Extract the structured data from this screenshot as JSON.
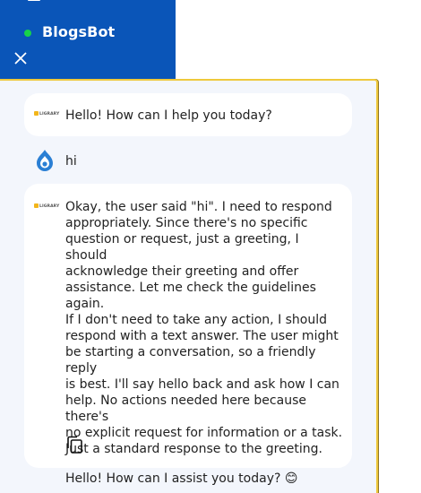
{
  "header": {
    "bot_name": "BlogsBot",
    "status_color": "#17d34b",
    "background": "#0a55b8"
  },
  "messages": [
    {
      "role": "bot",
      "text": "Hello! How can I help you today?"
    },
    {
      "role": "user",
      "text": "hi"
    },
    {
      "role": "bot",
      "reasoning_lines": [
        "Okay, the user said \"hi\". I need to respond",
        "appropriately. Since there's no specific",
        "question or request, just a greeting, I should",
        "acknowledge their greeting and offer",
        "assistance. Let me check the guidelines again.",
        "If I don't need to take any action, I should",
        "respond with a text answer. The user might",
        "be starting a conversation, so a friendly reply",
        "is best. I'll say hello back and ask how I can",
        "help. No actions needed here because there's",
        "no explicit request for information or a task.",
        "Just a standard response to the greeting."
      ],
      "reply": "Hello! How can I assist you today? 😊"
    }
  ],
  "bot_logo_text": "LIGRARY",
  "icons": {
    "menu": "menu-icon",
    "close": "close-icon",
    "bot_avatar": "bot-logo-icon",
    "user_avatar": "drupal-drop-icon",
    "copy": "copy-icon"
  }
}
